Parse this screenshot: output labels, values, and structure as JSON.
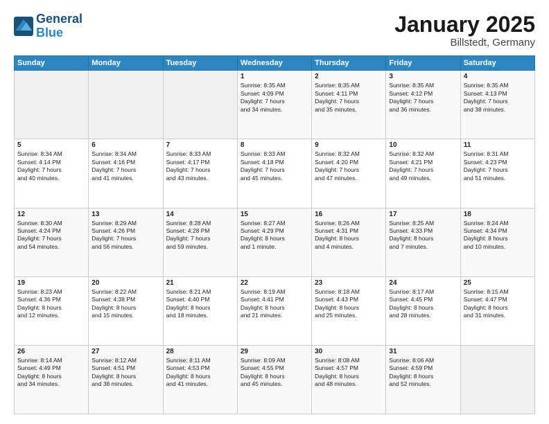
{
  "header": {
    "logo_line1": "General",
    "logo_line2": "Blue",
    "title": "January 2025",
    "location": "Billstedt, Germany"
  },
  "weekdays": [
    "Sunday",
    "Monday",
    "Tuesday",
    "Wednesday",
    "Thursday",
    "Friday",
    "Saturday"
  ],
  "weeks": [
    [
      {
        "day": "",
        "info": ""
      },
      {
        "day": "",
        "info": ""
      },
      {
        "day": "",
        "info": ""
      },
      {
        "day": "1",
        "info": "Sunrise: 8:35 AM\nSunset: 4:09 PM\nDaylight: 7 hours\nand 34 minutes."
      },
      {
        "day": "2",
        "info": "Sunrise: 8:35 AM\nSunset: 4:11 PM\nDaylight: 7 hours\nand 35 minutes."
      },
      {
        "day": "3",
        "info": "Sunrise: 8:35 AM\nSunset: 4:12 PM\nDaylight: 7 hours\nand 36 minutes."
      },
      {
        "day": "4",
        "info": "Sunrise: 8:35 AM\nSunset: 4:13 PM\nDaylight: 7 hours\nand 38 minutes."
      }
    ],
    [
      {
        "day": "5",
        "info": "Sunrise: 8:34 AM\nSunset: 4:14 PM\nDaylight: 7 hours\nand 40 minutes."
      },
      {
        "day": "6",
        "info": "Sunrise: 8:34 AM\nSunset: 4:16 PM\nDaylight: 7 hours\nand 41 minutes."
      },
      {
        "day": "7",
        "info": "Sunrise: 8:33 AM\nSunset: 4:17 PM\nDaylight: 7 hours\nand 43 minutes."
      },
      {
        "day": "8",
        "info": "Sunrise: 8:33 AM\nSunset: 4:18 PM\nDaylight: 7 hours\nand 45 minutes."
      },
      {
        "day": "9",
        "info": "Sunrise: 8:32 AM\nSunset: 4:20 PM\nDaylight: 7 hours\nand 47 minutes."
      },
      {
        "day": "10",
        "info": "Sunrise: 8:32 AM\nSunset: 4:21 PM\nDaylight: 7 hours\nand 49 minutes."
      },
      {
        "day": "11",
        "info": "Sunrise: 8:31 AM\nSunset: 4:23 PM\nDaylight: 7 hours\nand 51 minutes."
      }
    ],
    [
      {
        "day": "12",
        "info": "Sunrise: 8:30 AM\nSunset: 4:24 PM\nDaylight: 7 hours\nand 54 minutes."
      },
      {
        "day": "13",
        "info": "Sunrise: 8:29 AM\nSunset: 4:26 PM\nDaylight: 7 hours\nand 56 minutes."
      },
      {
        "day": "14",
        "info": "Sunrise: 8:28 AM\nSunset: 4:28 PM\nDaylight: 7 hours\nand 59 minutes."
      },
      {
        "day": "15",
        "info": "Sunrise: 8:27 AM\nSunset: 4:29 PM\nDaylight: 8 hours\nand 1 minute."
      },
      {
        "day": "16",
        "info": "Sunrise: 8:26 AM\nSunset: 4:31 PM\nDaylight: 8 hours\nand 4 minutes."
      },
      {
        "day": "17",
        "info": "Sunrise: 8:25 AM\nSunset: 4:33 PM\nDaylight: 8 hours\nand 7 minutes."
      },
      {
        "day": "18",
        "info": "Sunrise: 8:24 AM\nSunset: 4:34 PM\nDaylight: 8 hours\nand 10 minutes."
      }
    ],
    [
      {
        "day": "19",
        "info": "Sunrise: 8:23 AM\nSunset: 4:36 PM\nDaylight: 8 hours\nand 12 minutes."
      },
      {
        "day": "20",
        "info": "Sunrise: 8:22 AM\nSunset: 4:38 PM\nDaylight: 8 hours\nand 15 minutes."
      },
      {
        "day": "21",
        "info": "Sunrise: 8:21 AM\nSunset: 4:40 PM\nDaylight: 8 hours\nand 18 minutes."
      },
      {
        "day": "22",
        "info": "Sunrise: 8:19 AM\nSunset: 4:41 PM\nDaylight: 8 hours\nand 21 minutes."
      },
      {
        "day": "23",
        "info": "Sunrise: 8:18 AM\nSunset: 4:43 PM\nDaylight: 8 hours\nand 25 minutes."
      },
      {
        "day": "24",
        "info": "Sunrise: 8:17 AM\nSunset: 4:45 PM\nDaylight: 8 hours\nand 28 minutes."
      },
      {
        "day": "25",
        "info": "Sunrise: 8:15 AM\nSunset: 4:47 PM\nDaylight: 8 hours\nand 31 minutes."
      }
    ],
    [
      {
        "day": "26",
        "info": "Sunrise: 8:14 AM\nSunset: 4:49 PM\nDaylight: 8 hours\nand 34 minutes."
      },
      {
        "day": "27",
        "info": "Sunrise: 8:12 AM\nSunset: 4:51 PM\nDaylight: 8 hours\nand 38 minutes."
      },
      {
        "day": "28",
        "info": "Sunrise: 8:11 AM\nSunset: 4:53 PM\nDaylight: 8 hours\nand 41 minutes."
      },
      {
        "day": "29",
        "info": "Sunrise: 8:09 AM\nSunset: 4:55 PM\nDaylight: 8 hours\nand 45 minutes."
      },
      {
        "day": "30",
        "info": "Sunrise: 8:08 AM\nSunset: 4:57 PM\nDaylight: 8 hours\nand 48 minutes."
      },
      {
        "day": "31",
        "info": "Sunrise: 8:06 AM\nSunset: 4:59 PM\nDaylight: 8 hours\nand 52 minutes."
      },
      {
        "day": "",
        "info": ""
      }
    ]
  ]
}
